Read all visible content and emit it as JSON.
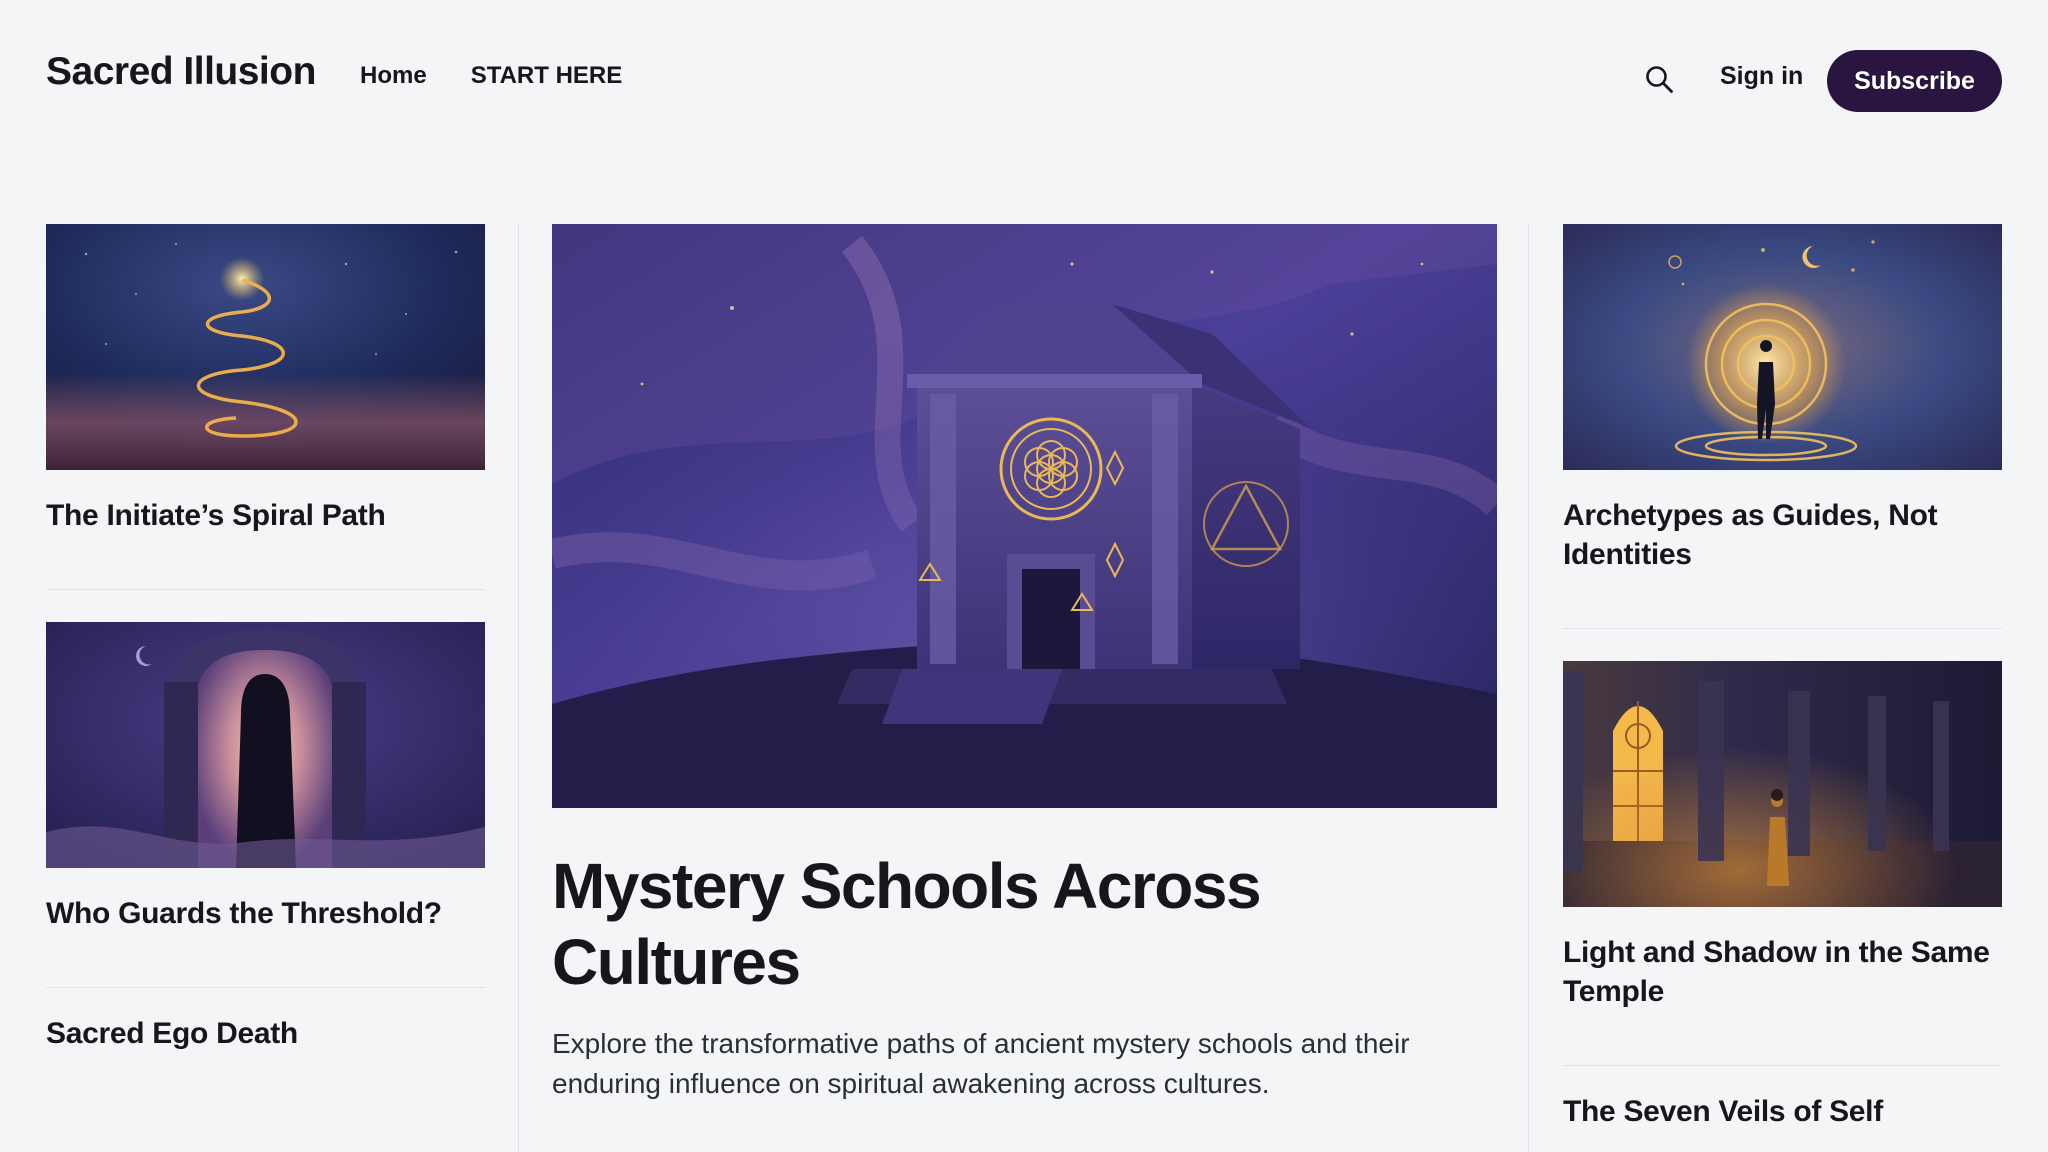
{
  "site": {
    "title": "Sacred Illusion"
  },
  "nav": {
    "items": [
      "Home",
      "START HERE"
    ]
  },
  "header": {
    "sign_in": "Sign in",
    "subscribe": "Subscribe",
    "search_icon": "search-icon"
  },
  "colors": {
    "subscribe_bg": "#2a1540",
    "background": "#f4f5f7",
    "text": "#15171a"
  },
  "left_posts": [
    {
      "title": "The Initiate’s Spiral Path"
    },
    {
      "title": "Who Guards the Threshold?"
    },
    {
      "title": "Sacred Ego Death"
    }
  ],
  "featured": {
    "title": "Mystery Schools Across Cultures",
    "excerpt": "Explore the transformative paths of ancient mystery schools and their enduring influence on spiritual awakening across cultures."
  },
  "right_posts": [
    {
      "title": "Archetypes as Guides, Not Identities"
    },
    {
      "title": "Light and Shadow in the Same Temple"
    },
    {
      "title": "The Seven Veils of Self"
    }
  ]
}
